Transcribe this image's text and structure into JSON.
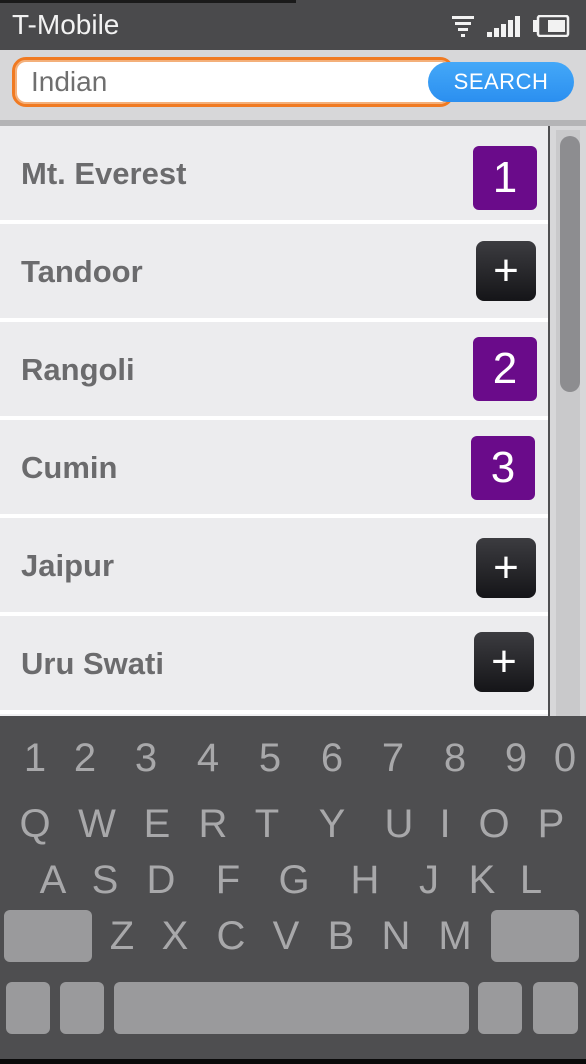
{
  "status_bar": {
    "carrier": "T-Mobile"
  },
  "search": {
    "value": "Indian",
    "button_label": "SEARCH"
  },
  "results": [
    {
      "name": "Mt. Everest",
      "rank": "1"
    },
    {
      "name": "Tandoor",
      "action": "+"
    },
    {
      "name": "Rangoli",
      "rank": "2"
    },
    {
      "name": "Cumin",
      "rank": "3"
    },
    {
      "name": "Jaipur",
      "action": "+"
    },
    {
      "name": "Uru Swati",
      "action": "+"
    }
  ],
  "keyboard": {
    "numbers": [
      "1",
      "2",
      "3",
      "4",
      "5",
      "6",
      "7",
      "8",
      "9",
      "0"
    ],
    "row1": [
      "Q",
      "W",
      "E",
      "R",
      "T",
      "Y",
      "U",
      "I",
      "O",
      "P"
    ],
    "row2": [
      "A",
      "S",
      "D",
      "F",
      "G",
      "H",
      "J",
      "K",
      "L"
    ],
    "row3": [
      "Z",
      "X",
      "C",
      "V",
      "B",
      "N",
      "M"
    ]
  },
  "colors": {
    "rank_badge": "#6a0b8a",
    "search_focus": "#f07a22",
    "search_button": "#2b8ff0"
  }
}
